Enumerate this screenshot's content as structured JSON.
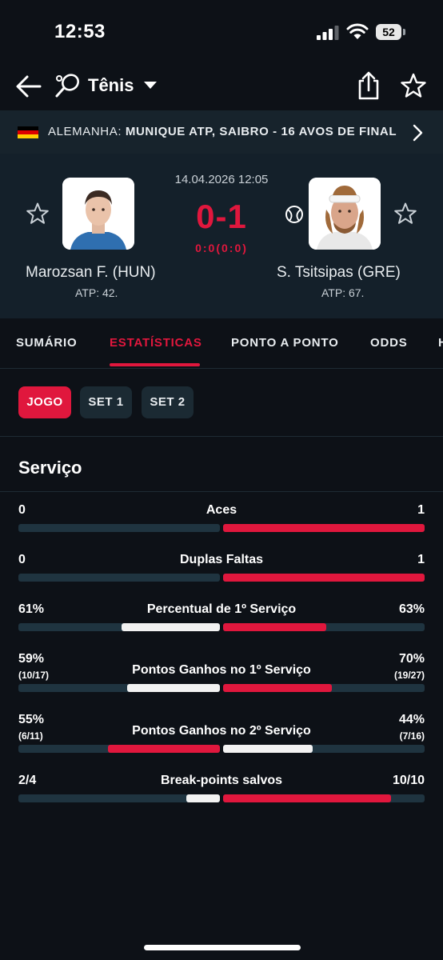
{
  "status_bar": {
    "time": "12:53",
    "battery": "52"
  },
  "header": {
    "sport": "Tênis",
    "icons": [
      "back-arrow-icon",
      "tennis-racket-icon",
      "share-icon",
      "star-icon"
    ]
  },
  "tournament": {
    "country": "ALEMANHA:",
    "name": "MUNIQUE ATP, SAIBRO - 16 AVOS DE FINAL"
  },
  "match": {
    "datetime": "14.04.2026 12:05",
    "score": "0-1",
    "set_score": "0:0(0:0)",
    "home": {
      "name": "Marozsan F. (HUN)",
      "rank": "ATP: 42."
    },
    "away": {
      "name": "S. Tsitsipas (GRE)",
      "rank": "ATP: 67."
    }
  },
  "tabs": [
    "SUMÁRIO",
    "ESTATÍSTICAS",
    "PONTO A PONTO",
    "ODDS",
    "H"
  ],
  "active_tab": "ESTATÍSTICAS",
  "filters": [
    "JOGO",
    "SET 1",
    "SET 2"
  ],
  "active_filter": "JOGO",
  "section_title": "Serviço",
  "colors": {
    "accent": "#e0173d",
    "highlight": "#f2f2f2",
    "track": "#1f3440",
    "background": "#0d1117"
  },
  "stats": [
    {
      "label": "Aces",
      "left": "0",
      "right": "1",
      "left_sub": "",
      "right_sub": "",
      "left_frac": 0,
      "right_frac": 1,
      "left_color": "highlight",
      "right_color": "accent"
    },
    {
      "label": "Duplas Faltas",
      "left": "0",
      "right": "1",
      "left_sub": "",
      "right_sub": "",
      "left_frac": 0,
      "right_frac": 1,
      "left_color": "highlight",
      "right_color": "accent"
    },
    {
      "label": "Percentual de 1º Serviço",
      "left": "61%",
      "right": "63%",
      "left_sub": "",
      "right_sub": "",
      "left_frac": 0.49,
      "right_frac": 0.51,
      "left_color": "highlight",
      "right_color": "accent"
    },
    {
      "label": "Pontos Ganhos no 1º Serviço",
      "left": "59%",
      "right": "70%",
      "left_sub": "(10/17)",
      "right_sub": "(19/27)",
      "left_frac": 0.46,
      "right_frac": 0.54,
      "left_color": "highlight",
      "right_color": "accent"
    },
    {
      "label": "Pontos Ganhos no 2º Serviço",
      "left": "55%",
      "right": "44%",
      "left_sub": "(6/11)",
      "right_sub": "(7/16)",
      "left_frac": 0.556,
      "right_frac": 0.444,
      "left_color": "accent",
      "right_color": "highlight"
    },
    {
      "label": "Break-points salvos",
      "left": "2/4",
      "right": "10/10",
      "left_sub": "",
      "right_sub": "",
      "left_frac": 0.167,
      "right_frac": 0.833,
      "left_color": "highlight",
      "right_color": "accent"
    }
  ]
}
